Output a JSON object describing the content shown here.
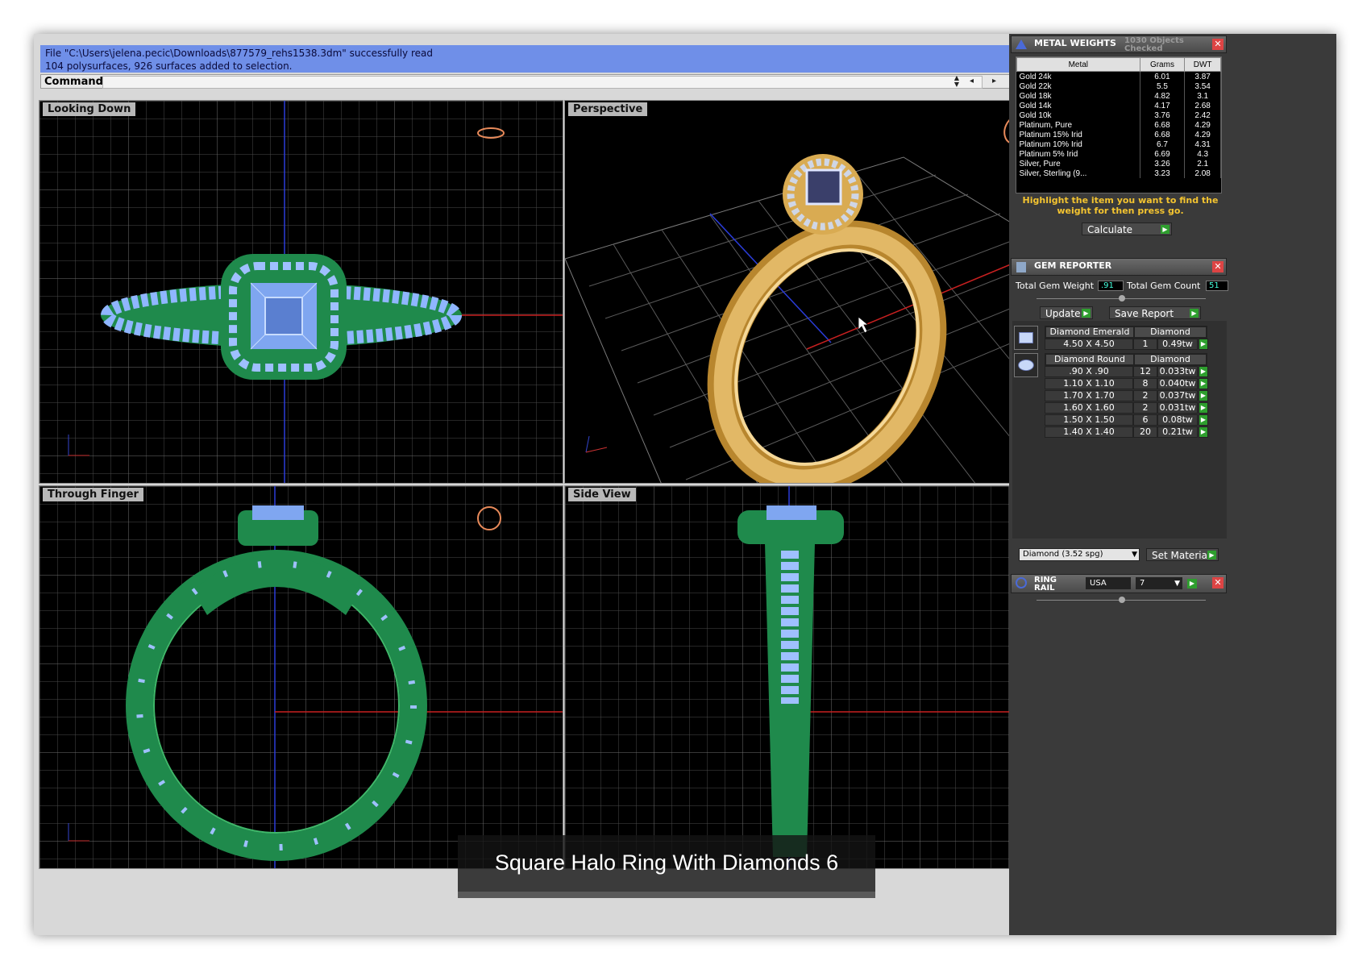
{
  "command": {
    "history": [
      "File \"C:\\Users\\jelena.pecic\\Downloads\\877579_rehs1538.3dm\" successfully read",
      "104 polysurfaces, 926 surfaces added to selection."
    ],
    "label": "Command:",
    "value": ""
  },
  "viewports": [
    {
      "title": "Looking Down"
    },
    {
      "title": "Perspective"
    },
    {
      "title": "Through Finger"
    },
    {
      "title": "Side View"
    }
  ],
  "caption": "Square Halo Ring With Diamonds 6",
  "metal_weights": {
    "title": "METAL WEIGHTS",
    "objects_checked": "1030 Objects Checked",
    "columns": [
      "Metal",
      "Grams",
      "DWT"
    ],
    "rows": [
      [
        "Gold 24k",
        "6.01",
        "3.87"
      ],
      [
        "Gold 22k",
        "5.5",
        "3.54"
      ],
      [
        "Gold 18k",
        "4.82",
        "3.1"
      ],
      [
        "Gold 14k",
        "4.17",
        "2.68"
      ],
      [
        "Gold 10k",
        "3.76",
        "2.42"
      ],
      [
        "Platinum, Pure",
        "6.68",
        "4.29"
      ],
      [
        "Platinum 15% Irid",
        "6.68",
        "4.29"
      ],
      [
        "Platinum 10% Irid",
        "6.7",
        "4.31"
      ],
      [
        "Platinum 5% Irid",
        "6.69",
        "4.3"
      ],
      [
        "Silver, Pure",
        "3.26",
        "2.1"
      ],
      [
        "Silver, Sterling (9...",
        "3.23",
        "2.08"
      ]
    ],
    "hint": "Highlight the item you want to find the weight for then press go.",
    "calculate_label": "Calculate"
  },
  "gem_reporter": {
    "title": "GEM REPORTER",
    "total_weight_label": "Total Gem Weight",
    "total_weight": ".91",
    "total_count_label": "Total Gem Count",
    "total_count": "51",
    "update_label": "Update",
    "save_report_label": "Save Report",
    "groups": [
      {
        "shape": "Diamond Emerald",
        "material": "Diamond",
        "rows": [
          [
            "4.50 X 4.50",
            "1",
            "0.49tw"
          ]
        ]
      },
      {
        "shape": "Diamond Round",
        "material": "Diamond",
        "rows": [
          [
            ".90 X .90",
            "12",
            "0.033tw"
          ],
          [
            "1.10 X 1.10",
            "8",
            "0.040tw"
          ],
          [
            "1.70 X 1.70",
            "2",
            "0.037tw"
          ],
          [
            "1.60 X 1.60",
            "2",
            "0.031tw"
          ],
          [
            "1.50 X 1.50",
            "6",
            "0.08tw"
          ],
          [
            "1.40 X 1.40",
            "20",
            "0.21tw"
          ]
        ]
      }
    ],
    "material_select": "Diamond    (3.52 spg)",
    "set_material_label": "Set Material"
  },
  "ring_rail": {
    "title": "RING RAIL",
    "region": "USA",
    "size": "7"
  }
}
